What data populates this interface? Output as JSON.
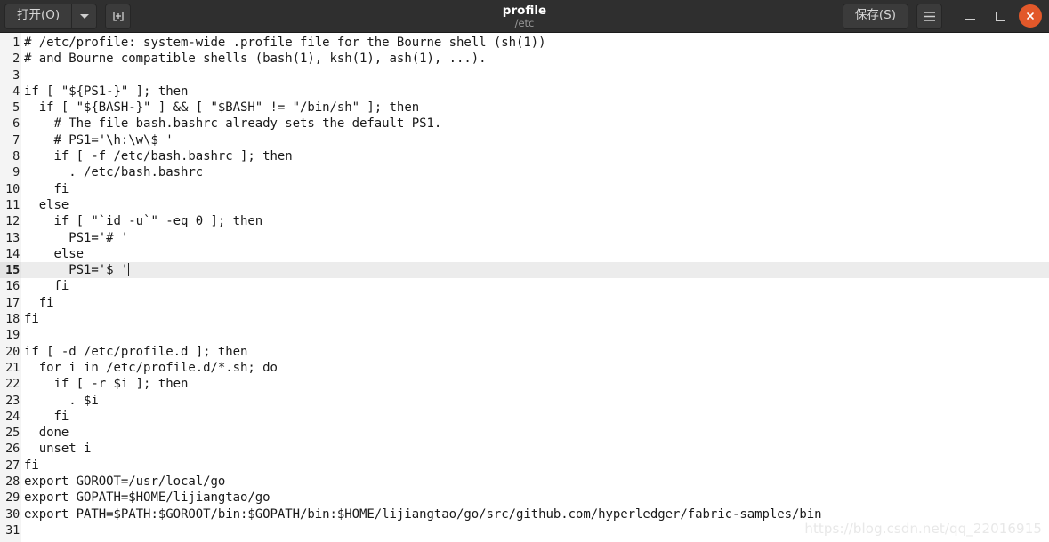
{
  "titlebar": {
    "open_label": "打开(O)",
    "open_dropdown_icon": "chevron-down-icon",
    "new_document_icon": "new-document-icon",
    "title": "profile",
    "subtitle": "/etc",
    "save_label": "保存(S)",
    "menu_icon": "hamburger-menu-icon",
    "minimize_icon": "minimize-icon",
    "maximize_icon": "maximize-icon",
    "close_icon": "close-icon",
    "close_button_color": "#e2582a",
    "background_color": "#2f2f2f"
  },
  "editor": {
    "current_line": 15,
    "current_line_highlight_color": "#ececec",
    "gutter_background": "#f4f4f4",
    "text_color": "#1a1a1a",
    "background_color": "#ffffff",
    "lines": [
      {
        "n": "1",
        "text": "# /etc/profile: system-wide .profile file for the Bourne shell (sh(1))"
      },
      {
        "n": "2",
        "text": "# and Bourne compatible shells (bash(1), ksh(1), ash(1), ...)."
      },
      {
        "n": "3",
        "text": ""
      },
      {
        "n": "4",
        "text": "if [ \"${PS1-}\" ]; then"
      },
      {
        "n": "5",
        "text": "  if [ \"${BASH-}\" ] && [ \"$BASH\" != \"/bin/sh\" ]; then"
      },
      {
        "n": "6",
        "text": "    # The file bash.bashrc already sets the default PS1."
      },
      {
        "n": "7",
        "text": "    # PS1='\\h:\\w\\$ '"
      },
      {
        "n": "8",
        "text": "    if [ -f /etc/bash.bashrc ]; then"
      },
      {
        "n": "9",
        "text": "      . /etc/bash.bashrc"
      },
      {
        "n": "10",
        "text": "    fi"
      },
      {
        "n": "11",
        "text": "  else"
      },
      {
        "n": "12",
        "text": "    if [ \"`id -u`\" -eq 0 ]; then"
      },
      {
        "n": "13",
        "text": "      PS1='# '"
      },
      {
        "n": "14",
        "text": "    else"
      },
      {
        "n": "15",
        "text": "      PS1='$ '"
      },
      {
        "n": "16",
        "text": "    fi"
      },
      {
        "n": "17",
        "text": "  fi"
      },
      {
        "n": "18",
        "text": "fi"
      },
      {
        "n": "19",
        "text": ""
      },
      {
        "n": "20",
        "text": "if [ -d /etc/profile.d ]; then"
      },
      {
        "n": "21",
        "text": "  for i in /etc/profile.d/*.sh; do"
      },
      {
        "n": "22",
        "text": "    if [ -r $i ]; then"
      },
      {
        "n": "23",
        "text": "      . $i"
      },
      {
        "n": "24",
        "text": "    fi"
      },
      {
        "n": "25",
        "text": "  done"
      },
      {
        "n": "26",
        "text": "  unset i"
      },
      {
        "n": "27",
        "text": "fi"
      },
      {
        "n": "28",
        "text": "export GOROOT=/usr/local/go"
      },
      {
        "n": "29",
        "text": "export GOPATH=$HOME/lijiangtao/go"
      },
      {
        "n": "30",
        "text": "export PATH=$PATH:$GOROOT/bin:$GOPATH/bin:$HOME/lijiangtao/go/src/github.com/hyperledger/fabric-samples/bin"
      },
      {
        "n": "31",
        "text": ""
      }
    ]
  },
  "watermark": {
    "text": "https://blog.csdn.net/qq_22016915"
  }
}
